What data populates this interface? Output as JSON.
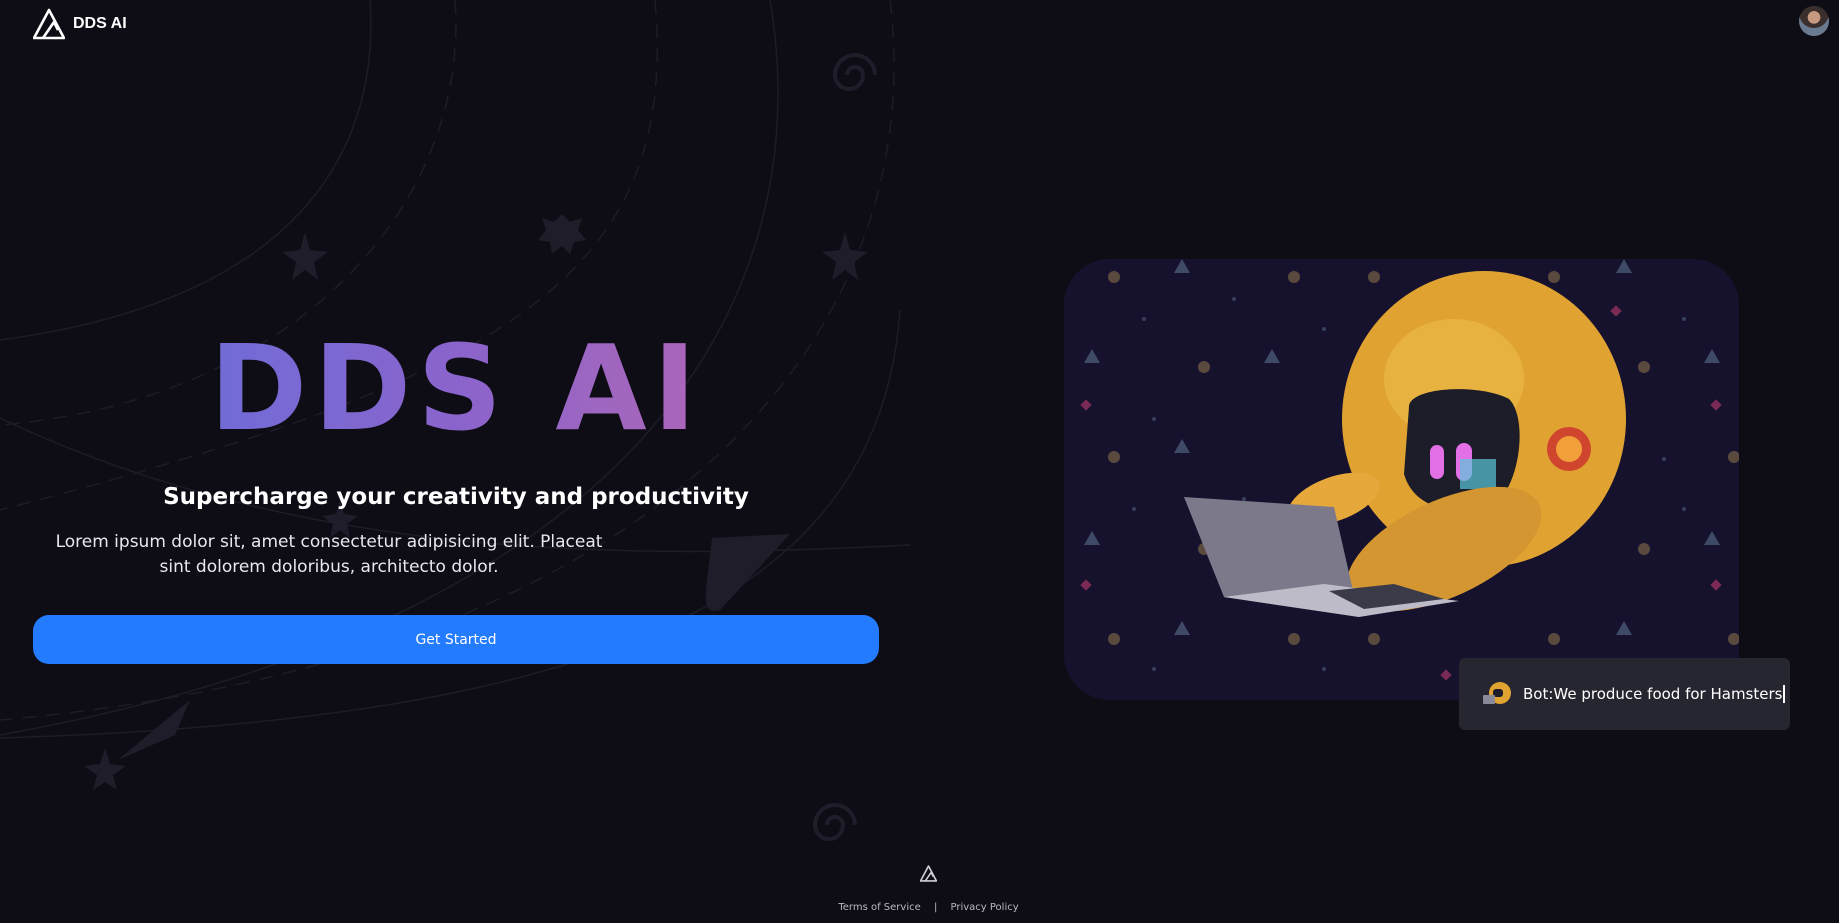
{
  "header": {
    "brand_name": "DDS AI"
  },
  "hero": {
    "title": "DDS AI",
    "subtitle": "Supercharge your creativity and productivity",
    "description": "Lorem ipsum dolor sit, amet consectetur adipisicing elit. Placeat sint dolorem doloribus, architecto dolor.",
    "cta_label": "Get Started"
  },
  "chat": {
    "message": "Bot:We produce food for Hamsters"
  },
  "footer": {
    "terms_label": "Terms of Service",
    "separator": "|",
    "privacy_label": "Privacy Policy"
  },
  "colors": {
    "background": "#0e0d16",
    "accent_button": "#237bff",
    "title_gradient_start": "#5b72e0",
    "title_gradient_end": "#c869a8",
    "card_background": "#16122e",
    "chat_background": "#262630"
  },
  "icons": [
    "logo-icon",
    "avatar",
    "robot-icon",
    "footer-logo-icon"
  ]
}
